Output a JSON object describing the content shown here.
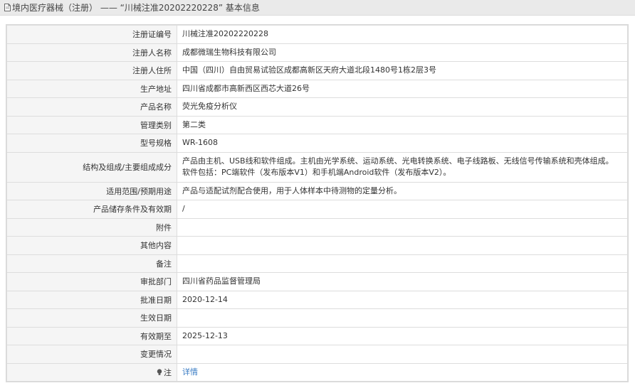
{
  "header": {
    "title": "境内医疗器械（注册） —— “川械注准20202220228” 基本信息"
  },
  "rows": [
    {
      "label": "注册证编号",
      "value": "川械注准20202220228"
    },
    {
      "label": "注册人名称",
      "value": "成都微瑞生物科技有限公司"
    },
    {
      "label": "注册人住所",
      "value": "中国（四川）自由贸易试验区成都高新区天府大道北段1480号1栋2层3号"
    },
    {
      "label": "生产地址",
      "value": "四川省成都市高新西区西芯大道26号"
    },
    {
      "label": "产品名称",
      "value": "荧光免疫分析仪"
    },
    {
      "label": "管理类别",
      "value": "第二类"
    },
    {
      "label": "型号规格",
      "value": "WR-1608"
    },
    {
      "label": "结构及组成/主要组成成分",
      "value": "产品由主机、USB线和软件组成。主机由光学系统、运动系统、光电转换系统、电子线路板、无线信号传输系统和壳体组成。软件包括：PC端软件（发布版本V1）和手机端Android软件（发布版本V2）。"
    },
    {
      "label": "适用范围/预期用途",
      "value": "产品与适配试剂配合使用，用于人体样本中待测物的定量分析。"
    },
    {
      "label": "产品储存条件及有效期",
      "value": "/"
    },
    {
      "label": "附件",
      "value": ""
    },
    {
      "label": "其他内容",
      "value": ""
    },
    {
      "label": "备注",
      "value": ""
    },
    {
      "label": "审批部门",
      "value": "四川省药品监督管理局"
    },
    {
      "label": "批准日期",
      "value": "2020-12-14"
    },
    {
      "label": "生效日期",
      "value": ""
    },
    {
      "label": "有效期至",
      "value": "2025-12-13"
    },
    {
      "label": "变更情况",
      "value": ""
    },
    {
      "label": "注",
      "value": "详情"
    }
  ],
  "colors": {
    "header_bg": "#eaeaea",
    "label_bg": "#f5f5f5",
    "border": "#dddddd",
    "link": "#3a7cc4"
  },
  "icons": {
    "header": "document-icon",
    "note": "lightbulb-icon"
  }
}
